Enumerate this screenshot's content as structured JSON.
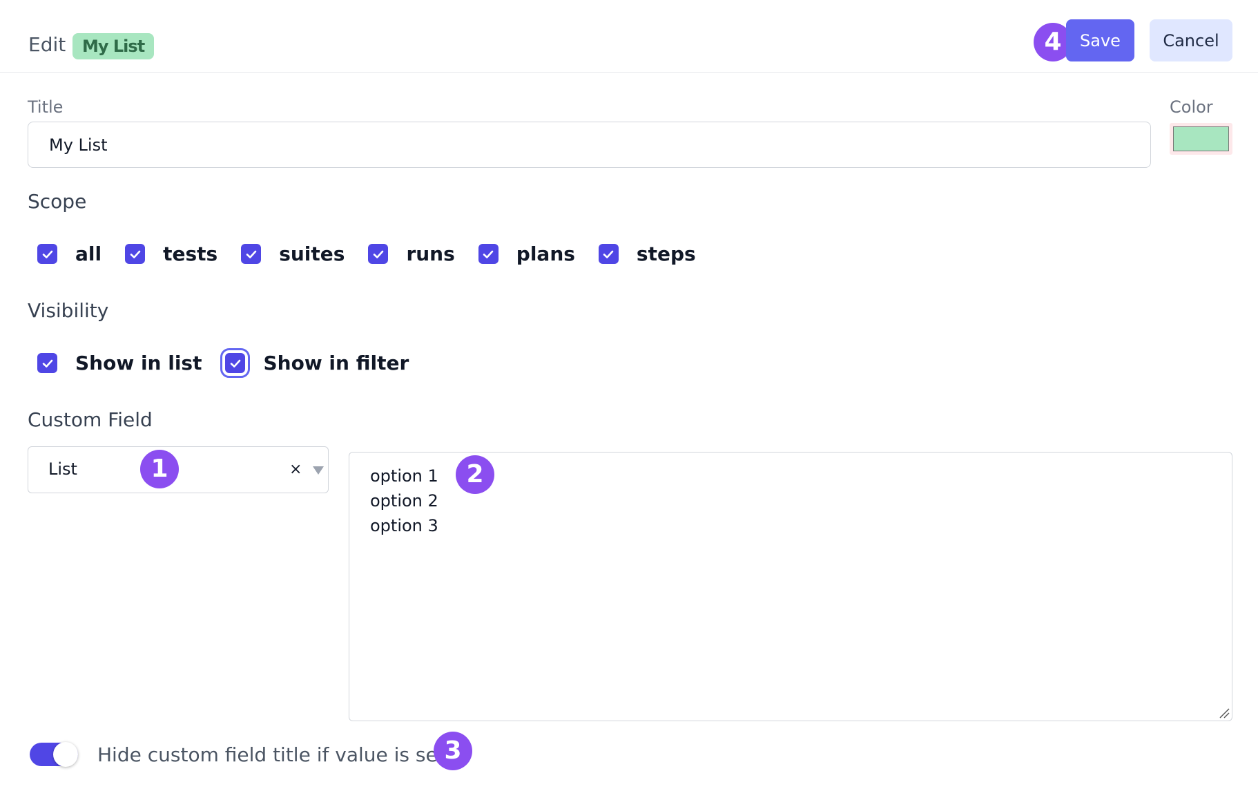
{
  "header": {
    "edit_label": "Edit",
    "title_badge": "My List",
    "save_label": "Save",
    "cancel_label": "Cancel"
  },
  "form": {
    "title_label": "Title",
    "title_value": "My List",
    "color_label": "Color",
    "color_value": "#a8e6c0",
    "scope_label": "Scope",
    "scope_items": [
      {
        "label": "all",
        "checked": true
      },
      {
        "label": "tests",
        "checked": true
      },
      {
        "label": "suites",
        "checked": true
      },
      {
        "label": "runs",
        "checked": true
      },
      {
        "label": "plans",
        "checked": true
      },
      {
        "label": "steps",
        "checked": true
      }
    ],
    "visibility_label": "Visibility",
    "visibility_items": [
      {
        "label": "Show in list",
        "checked": true
      },
      {
        "label": "Show in filter",
        "checked": true,
        "focused": true
      }
    ],
    "custom_field_label": "Custom Field",
    "custom_field_type": "List",
    "custom_field_options": [
      "option 1",
      "option 2",
      "option 3"
    ],
    "hide_title_label": "Hide custom field title if value is set",
    "hide_title_enabled": true
  },
  "markers": [
    "1",
    "2",
    "3",
    "4"
  ],
  "colors": {
    "accent": "#4f46e5",
    "save_button": "#6366f1",
    "cancel_button": "#e0e7ff",
    "badge": "#a8e6c0",
    "marker": "#8b4ef0"
  }
}
